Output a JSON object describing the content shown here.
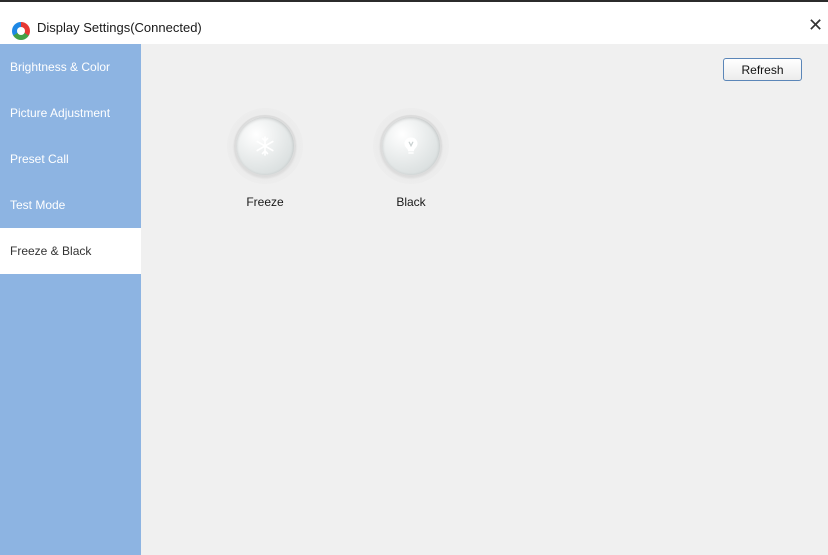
{
  "window": {
    "title": "Display Settings(Connected)",
    "close_glyph": "✕"
  },
  "sidebar": {
    "items": [
      {
        "label": "Brightness & Color"
      },
      {
        "label": "Picture Adjustment"
      },
      {
        "label": "Preset Call"
      },
      {
        "label": "Test Mode"
      },
      {
        "label": "Freeze & Black",
        "active": true
      }
    ]
  },
  "main": {
    "refresh_label": "Refresh",
    "actions": [
      {
        "label": "Freeze",
        "icon": "snowflake-icon"
      },
      {
        "label": "Black",
        "icon": "lightbulb-icon"
      }
    ]
  },
  "colors": {
    "sidebar": "#8db4e2",
    "content_bg": "#f0f0f0",
    "active_item": "#ffffff"
  }
}
